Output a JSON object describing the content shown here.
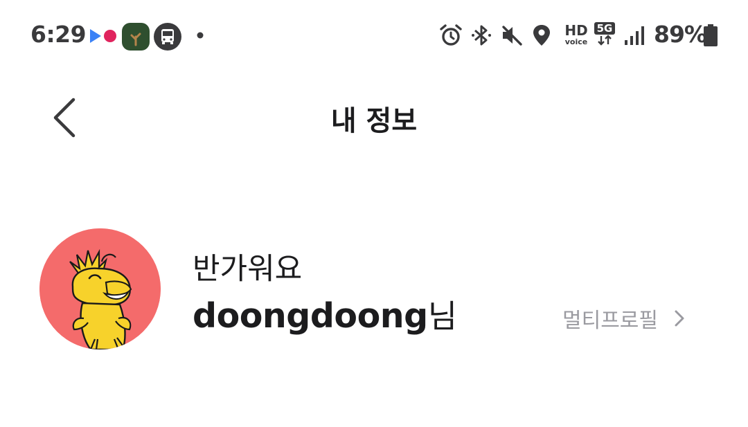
{
  "status_bar": {
    "time": "6:29",
    "battery": "89%",
    "notification_icons": [
      "media-playback-icon",
      "tree-app-icon",
      "bus-icon",
      "more-dot-icon"
    ],
    "system_icons": [
      "alarm-icon",
      "bluetooth-icon",
      "mute-icon",
      "location-icon",
      "hd-voice-icon",
      "5g-icon",
      "signal-icon",
      "battery-icon"
    ],
    "hd_label": "HD",
    "voice_label": "voice",
    "network_label": "5G"
  },
  "header": {
    "title": "내 정보",
    "back_icon": "chevron-left-icon"
  },
  "profile": {
    "greeting": "반가워요",
    "username": "doongdoong",
    "honorific": "님",
    "avatar_bg": "#f46b6b",
    "multi_profile_label": "멀티프로필",
    "multi_profile_icon": "chevron-right-icon"
  }
}
